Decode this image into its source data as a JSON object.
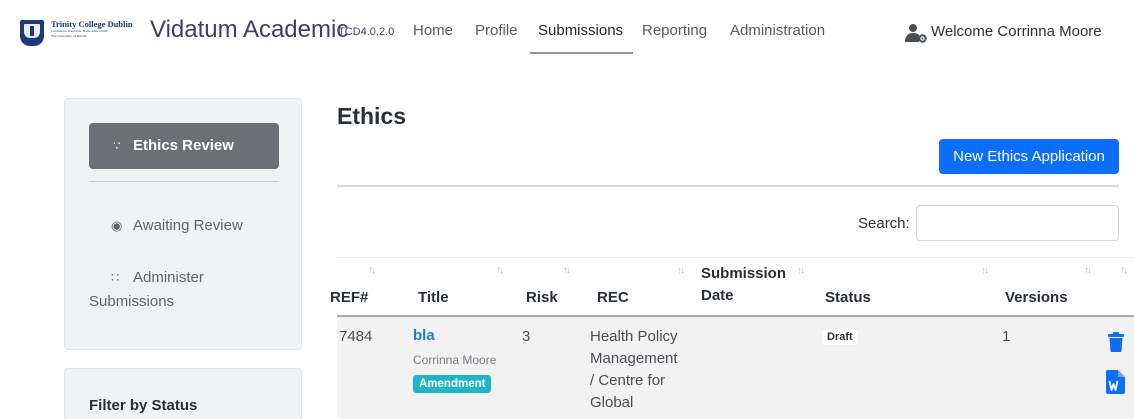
{
  "header": {
    "institution": {
      "line1": "Trinity College Dublin",
      "line2": "Coláiste na Tríonóide, Baile Átha Cliath",
      "line3": "The University of Dublin"
    },
    "app_name": "Vidatum Academic",
    "version": "TCD4.0.2.0",
    "nav": [
      {
        "label": "Home",
        "active": false
      },
      {
        "label": "Profile",
        "active": false
      },
      {
        "label": "Submissions",
        "active": true
      },
      {
        "label": "Reporting",
        "active": false
      },
      {
        "label": "Administration",
        "active": false
      }
    ],
    "user_icon": "user-gear-icon",
    "welcome": "Welcome Corrinna Moore"
  },
  "sidebar": {
    "items": [
      {
        "label": "Ethics Review",
        "icon": "tree-icon",
        "active": true
      },
      {
        "label": "Awaiting Review",
        "icon": "cube-icon",
        "active": false
      },
      {
        "label_line1": "Administer",
        "label_line2": "Submissions",
        "icon": "users-icon",
        "active": false
      }
    ],
    "filter_title": "Filter by Status"
  },
  "main": {
    "title": "Ethics",
    "new_button": "New Ethics Application",
    "search_label": "Search:",
    "search_value": "",
    "table": {
      "columns": [
        "REF#",
        "Title",
        "Risk",
        "REC",
        "Submission Date",
        "Status",
        "Versions"
      ],
      "submission_line1": "Submission",
      "submission_line2": "Date",
      "rows": [
        {
          "ref": "7484",
          "title": "bla",
          "author": "Corrinna Moore",
          "badge": "Amendment",
          "risk": "3",
          "rec_lines": [
            "Health Policy",
            "Management",
            "/ Centre for",
            "Global"
          ],
          "submission_date": "",
          "status": "Draft",
          "versions": "1"
        }
      ]
    }
  },
  "colors": {
    "primary": "#0b6efd",
    "brand": "#3a3f73",
    "link": "#1b7bd6",
    "amendment_badge": "#1fb5c8",
    "sidebar_active": "#6c6f73"
  }
}
